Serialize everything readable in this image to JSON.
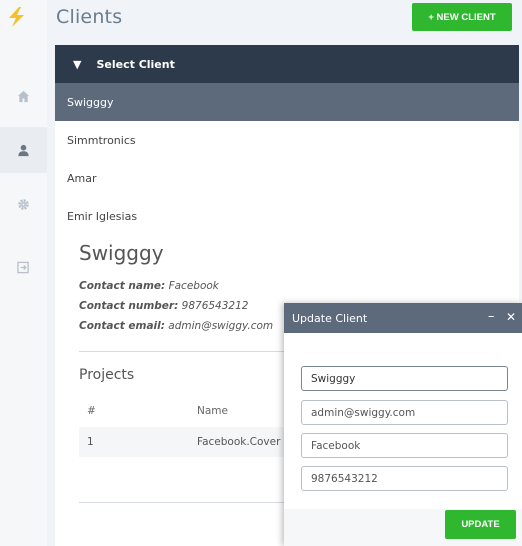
{
  "app": {
    "page_title": "Clients",
    "new_client_label": "+ NEW CLIENT"
  },
  "sidebar": {
    "items": [
      {
        "name": "home",
        "icon": "home-icon"
      },
      {
        "name": "clients",
        "icon": "user-icon",
        "active": true
      },
      {
        "name": "settings",
        "icon": "gear-icon"
      },
      {
        "name": "logout",
        "icon": "sign-out-icon"
      }
    ]
  },
  "client_list": {
    "header_label": "Select Client",
    "items": [
      "Swigggy",
      "Simmtronics",
      "Amar",
      "Emir Iglesias"
    ],
    "selected": "Swigggy"
  },
  "detail": {
    "name": "Swigggy",
    "contact_name_label": "Contact name:",
    "contact_name": "Facebook",
    "contact_number_label": "Contact number:",
    "contact_number": "9876543212",
    "contact_email_label": "Contact email:",
    "contact_email": "admin@swiggy.com",
    "projects_title": "Projects",
    "projects_columns": [
      "#",
      "Name"
    ],
    "projects_rows": [
      {
        "num": "1",
        "name": "Facebook.Cover"
      }
    ]
  },
  "update_modal": {
    "title": "Update Client",
    "minimize_symbol": "–",
    "close_symbol": "✕",
    "fields": {
      "client_name": "Swigggy",
      "email": "admin@swiggy.com",
      "contact_name": "Facebook",
      "contact_number": "9876543212"
    },
    "update_label": "UPDATE"
  },
  "colors": {
    "accent_green": "#2fb730",
    "header_dark": "#2d3a4b",
    "selected_slate": "#5c6a7c",
    "logo_yellow": "#f2c12e"
  }
}
